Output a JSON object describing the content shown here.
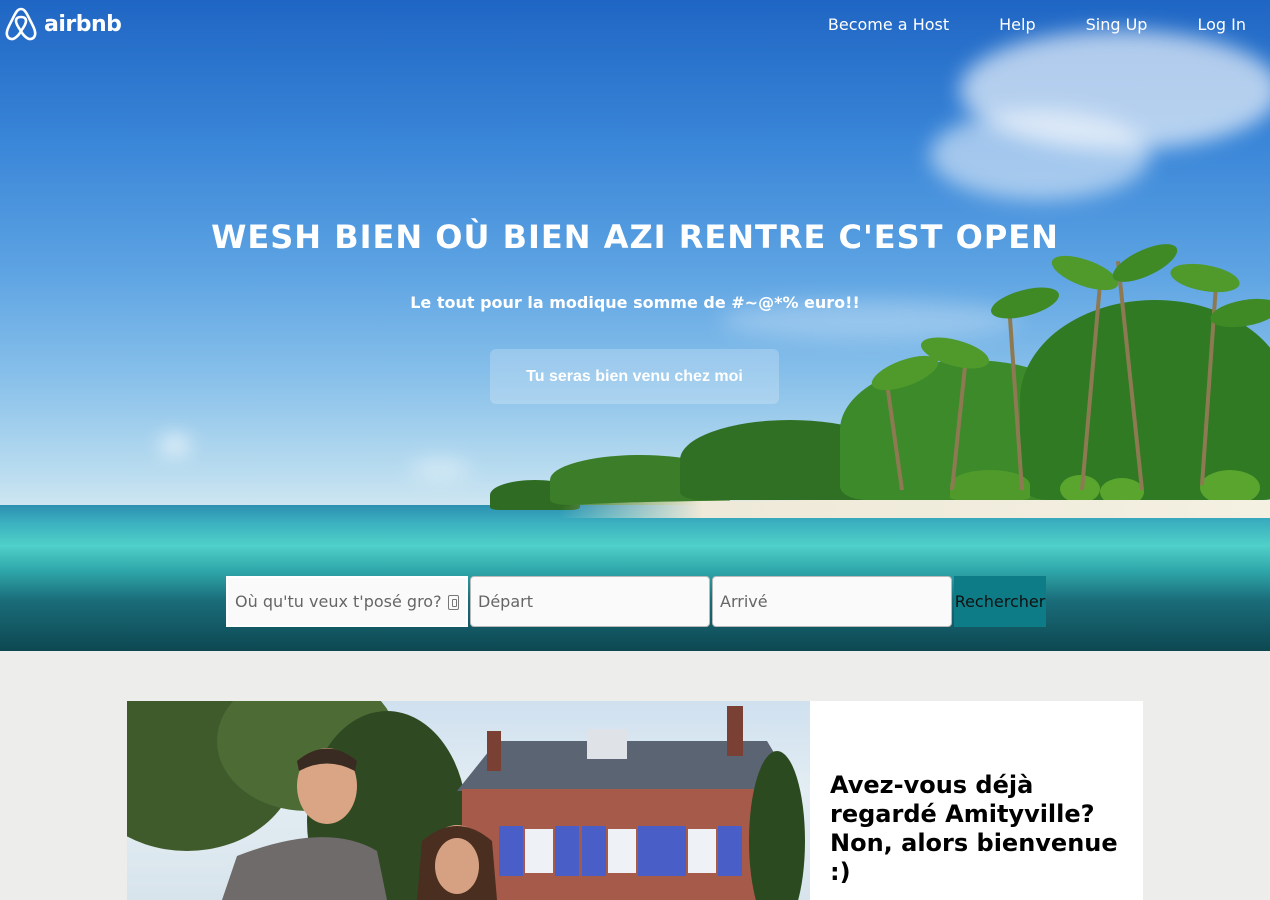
{
  "nav": {
    "logo_text": "airbnb",
    "links": [
      "Become a Host",
      "Help",
      "Sing Up",
      "Log In"
    ]
  },
  "hero": {
    "headline": "WESH BIEN OÙ BIEN AZI RENTRE C'EST OPEN",
    "subline": "Le tout pour la modique somme de #~@*% euro!!",
    "cta_label": "Tu seras bien venu chez moi"
  },
  "search": {
    "where_placeholder": "Où qu'tu veux t'posé gro?",
    "depart_placeholder": "Départ",
    "arrive_placeholder": "Arrivé",
    "button_label": "Rechercher"
  },
  "feature": {
    "title": "Avez-vous déjà regardé Amityville? Non, alors bienvenue :)"
  },
  "colors": {
    "search_button": "#0d7c86",
    "page_background": "#edeeeb"
  }
}
